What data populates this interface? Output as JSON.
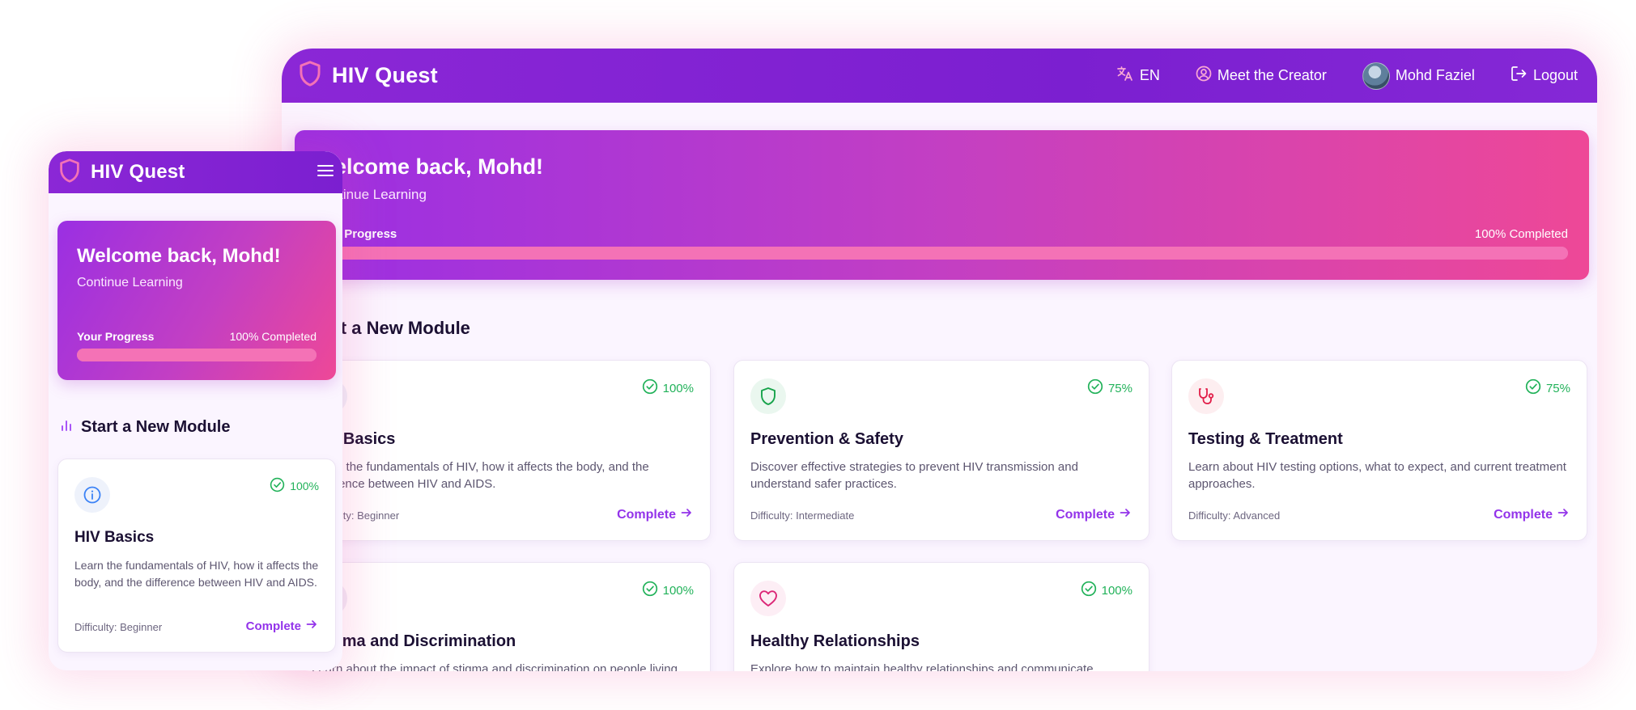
{
  "desktop": {
    "brand": "HIV Quest",
    "nav": {
      "language": "EN",
      "creator": "Meet the Creator",
      "user": "Mohd Faziel",
      "logout": "Logout"
    },
    "hero": {
      "welcome": "Welcome back, Mohd!",
      "subtitle": "Continue Learning",
      "progress_label": "Your Progress",
      "progress_done": "100% Completed",
      "progress_value": 1.0
    },
    "section_title": "Start a New Module",
    "cards": [
      {
        "title": "HIV Basics",
        "description": "Learn the fundamentals of HIV, how it affects the body, and the difference between HIV and AIDS.",
        "percent": "100%",
        "difficulty": "Difficulty: Beginner",
        "cta": "Complete",
        "icon": "info-icon"
      },
      {
        "title": "Prevention & Safety",
        "description": "Discover effective strategies to prevent HIV transmission and understand safer practices.",
        "percent": "75%",
        "difficulty": "Difficulty: Intermediate",
        "cta": "Complete",
        "icon": "shield-icon"
      },
      {
        "title": "Testing & Treatment",
        "description": "Learn about HIV testing options, what to expect, and current treatment approaches.",
        "percent": "75%",
        "difficulty": "Difficulty: Advanced",
        "cta": "Complete",
        "icon": "stethoscope-icon"
      },
      {
        "title": "Stigma and Discrimination",
        "description": "Learn about the impact of stigma and discrimination on people living with HIV.",
        "percent": "100%",
        "difficulty": "",
        "cta": "",
        "icon": ""
      },
      {
        "title": "Healthy Relationships",
        "description": "Explore how to maintain healthy relationships and communicate effectively.",
        "percent": "100%",
        "difficulty": "",
        "cta": "",
        "icon": "heart-icon"
      }
    ]
  },
  "mobile": {
    "brand": "HIV Quest",
    "hero": {
      "welcome": "Welcome back, Mohd!",
      "subtitle": "Continue Learning",
      "progress_label": "Your Progress",
      "progress_done": "100% Completed",
      "progress_value": 1.0
    },
    "section_title": "Start a New Module",
    "card": {
      "title": "HIV Basics",
      "description": "Learn the fundamentals of HIV, how it affects the body, and the difference between HIV and AIDS.",
      "percent": "100%",
      "difficulty": "Difficulty: Beginner",
      "cta": "Complete",
      "icon": "info-icon"
    }
  },
  "colors": {
    "primary": "#7b1fd0",
    "accent": "#9333ea",
    "pink": "#ec4899",
    "success": "#22b25a",
    "background": "#fbf5ff"
  }
}
